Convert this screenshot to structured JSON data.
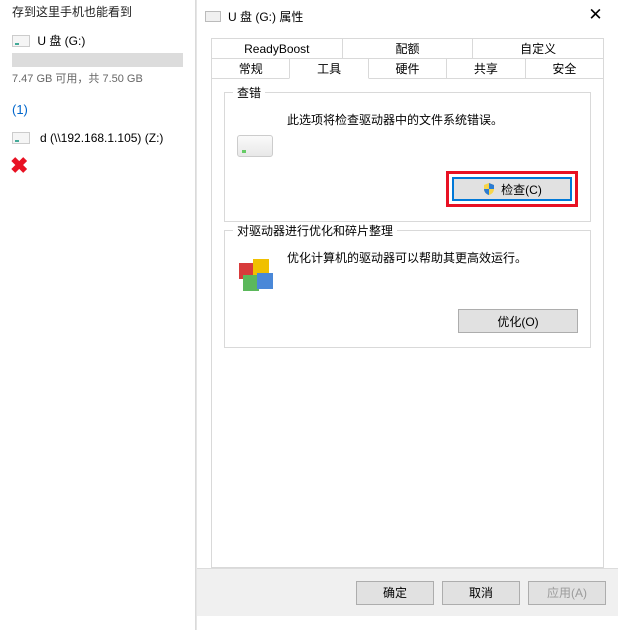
{
  "background": {
    "header_fragment": "存到这里手机也能看到",
    "drive": {
      "label": "U 盘 (G:)",
      "usage_text": "7.47 GB 可用，共 7.50 GB"
    },
    "section_num": "(1)",
    "network_drive": "d (\\\\192.168.1.105) (Z:)"
  },
  "dialog": {
    "title": "U 盘 (G:) 属性",
    "tabs_row1": [
      "ReadyBoost",
      "配额",
      "自定义"
    ],
    "tabs_row2": [
      "常规",
      "工具",
      "硬件",
      "共享",
      "安全"
    ],
    "active_tab": "工具",
    "check_group": {
      "title": "查错",
      "desc": "此选项将检查驱动器中的文件系统错误。",
      "button": "检查(C)"
    },
    "defrag_group": {
      "title": "对驱动器进行优化和碎片整理",
      "desc": "优化计算机的驱动器可以帮助其更高效运行。",
      "button": "优化(O)"
    },
    "footer": {
      "ok": "确定",
      "cancel": "取消",
      "apply": "应用(A)"
    }
  }
}
